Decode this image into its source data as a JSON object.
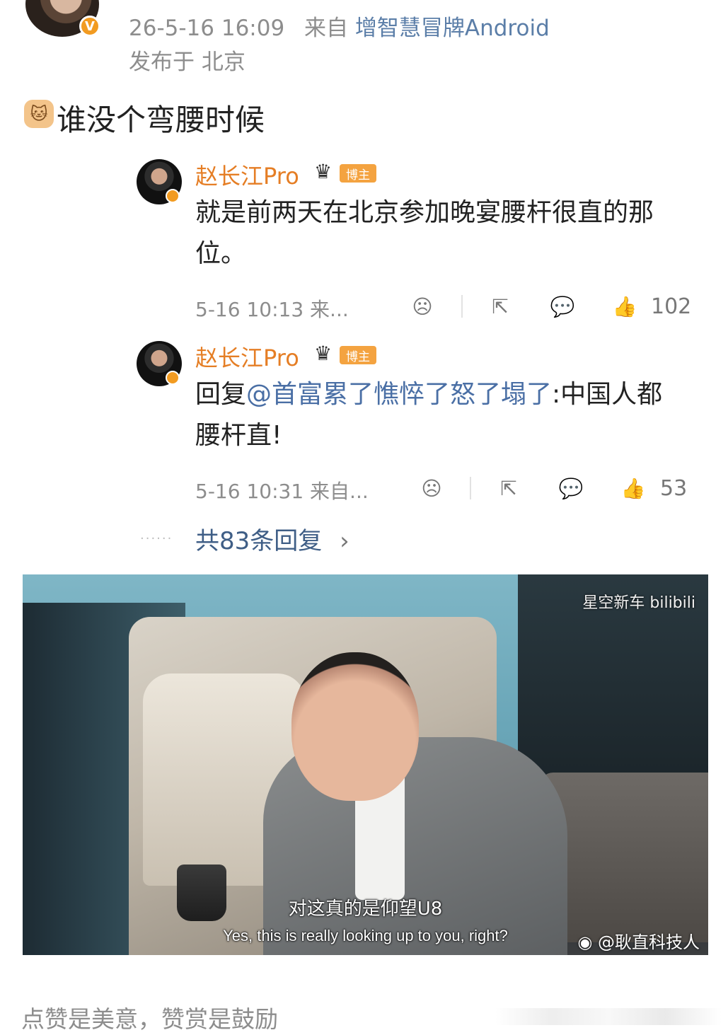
{
  "post": {
    "timestamp": "26-5-16 16:09",
    "source_prefix": "来自",
    "source": "增智慧冒牌Android",
    "location": "发布于 北京",
    "text": "谁没个弯腰时候"
  },
  "comments": [
    {
      "author": "赵长江Pro",
      "crown_icon": "crown-icon",
      "tag": "博主",
      "text": "就是前两天在北京参加晚宴腰杆很直的那位。",
      "meta": "5-16 10:13 来...",
      "likes": "102"
    },
    {
      "author": "赵长江Pro",
      "crown_icon": "crown-icon",
      "tag": "博主",
      "reply_prefix": "回复",
      "mention": "@首富累了憔悴了怒了塌了",
      "text_rest": ":中国人都腰杆直!",
      "meta": "5-16 10:31 来自...",
      "likes": "53"
    }
  ],
  "more_replies": {
    "dots": "......",
    "label": "共83条回复",
    "chevron": "›"
  },
  "video": {
    "watermark_top": "星空新车 bilibili",
    "subtitle_zh": "对这真的是仰望U8",
    "subtitle_en": "Yes, this is really looking up to you, right?",
    "watermark_bottom": "@耿直科技人"
  },
  "footer": {
    "text": "点赞是美意，赞赏是鼓励"
  },
  "colors": {
    "accent_orange": "#e57e25",
    "link_blue": "#4a6fa5",
    "meta_gray": "#8d8d8d"
  }
}
